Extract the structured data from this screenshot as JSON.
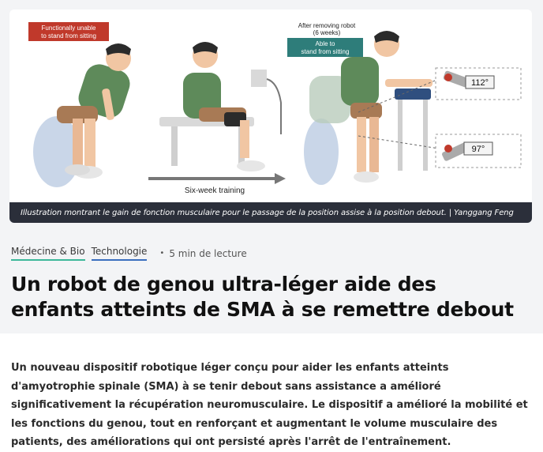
{
  "figure": {
    "labels": {
      "unable": [
        "Functionally unable",
        "to stand from sitting"
      ],
      "after": [
        "After removing robot",
        "(6 weeks)"
      ],
      "able": [
        "Able to",
        "stand from sitting"
      ],
      "training": "Six-week training",
      "angle_top": "112°",
      "angle_bottom": "97°"
    },
    "caption": "Illustration montrant le gain de fonction musculaire pour le passage de la position assise à la position debout. | Yanggang Feng",
    "colors": {
      "label_red": "#c0392b",
      "label_teal": "#2e7d7a",
      "caption_bg": "#2b2f3a"
    }
  },
  "article": {
    "tags": [
      "Médecine & Bio",
      "Technologie"
    ],
    "read_time": "5 min de lecture",
    "title": "Un robot de genou ultra-léger aide des enfants atteints de SMA à se remettre debout",
    "lede": "Un nouveau dispositif robotique léger conçu pour aider les enfants atteints d'amyotrophie spinale (SMA) à se tenir debout sans assistance a amélioré significativement la récupération neuromusculaire. Le dispositif a amélioré la mobilité et les fonctions du genou, tout en renforçant et augmentant le volume musculaire des patients, des améliorations qui ont persisté après l'arrêt de l'entraînement."
  }
}
